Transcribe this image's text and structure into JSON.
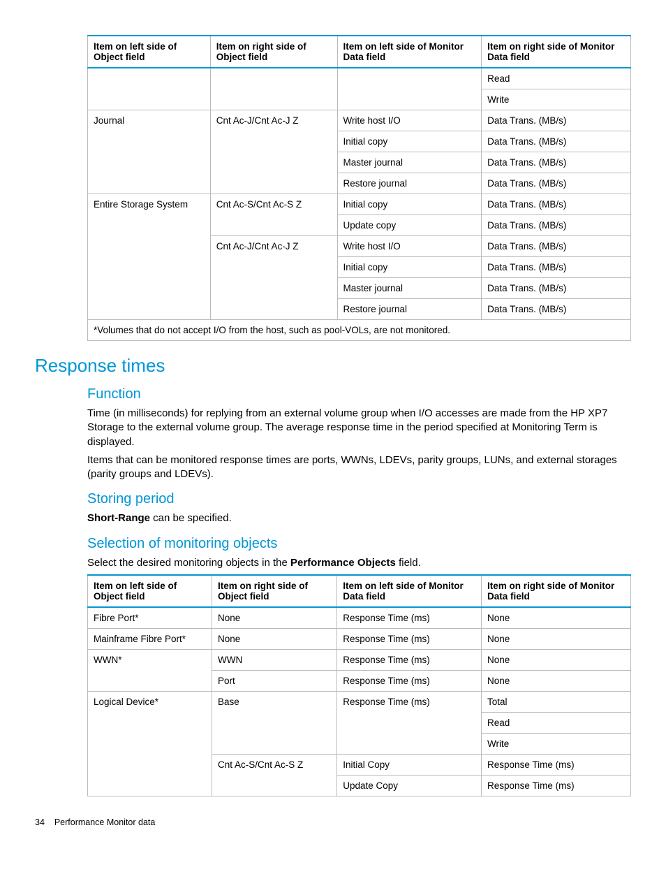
{
  "table1": {
    "headers": [
      "Item on left side of Object field",
      "Item on right side of Object field",
      "Item on left side of Monitor Data field",
      "Item on right side of Monitor Data field"
    ],
    "rows": [
      {
        "c0": "",
        "c1": "",
        "c2": "",
        "c3": "Read"
      },
      {
        "c0": "",
        "c1": "",
        "c2": "",
        "c3": "Write"
      },
      {
        "c0": "Journal",
        "c1": "Cnt Ac-J/Cnt Ac-J Z",
        "c2": "Write host I/O",
        "c3": "Data Trans. (MB/s)"
      },
      {
        "c0": "",
        "c1": "",
        "c2": "Initial copy",
        "c3": "Data Trans. (MB/s)"
      },
      {
        "c0": "",
        "c1": "",
        "c2": "Master journal",
        "c3": "Data Trans. (MB/s)"
      },
      {
        "c0": "",
        "c1": "",
        "c2": "Restore journal",
        "c3": "Data Trans. (MB/s)"
      },
      {
        "c0": "Entire Storage System",
        "c1": "Cnt Ac-S/Cnt Ac-S Z",
        "c2": "Initial copy",
        "c3": "Data Trans. (MB/s)"
      },
      {
        "c0": "",
        "c1": "",
        "c2": "Update copy",
        "c3": "Data Trans. (MB/s)"
      },
      {
        "c0": "",
        "c1": "Cnt Ac-J/Cnt Ac-J Z",
        "c2": "Write host I/O",
        "c3": "Data Trans. (MB/s)"
      },
      {
        "c0": "",
        "c1": "",
        "c2": "Initial copy",
        "c3": "Data Trans. (MB/s)"
      },
      {
        "c0": "",
        "c1": "",
        "c2": "Master journal",
        "c3": "Data Trans. (MB/s)"
      },
      {
        "c0": "",
        "c1": "",
        "c2": "Restore journal",
        "c3": "Data Trans. (MB/s)"
      }
    ],
    "footnote": "*Volumes that do not accept I/O from the host, such as pool-VOLs, are not monitored."
  },
  "section": {
    "title": "Response times",
    "function_heading": "Function",
    "function_p1": "Time (in milliseconds) for replying from an external volume group when I/O accesses are made from the HP XP7 Storage to the external volume group. The average response time in the period specified at Monitoring Term is displayed.",
    "function_p2": "Items that can be monitored response times are ports, WWNs, LDEVs, parity groups, LUNs, and external storages (parity groups and LDEVs).",
    "storing_heading": "Storing period",
    "storing_bold": "Short-Range",
    "storing_rest": " can be specified.",
    "selection_heading": "Selection of monitoring objects",
    "selection_pre": "Select the desired monitoring objects in the ",
    "selection_bold": "Performance Objects",
    "selection_post": " field."
  },
  "table2": {
    "headers": [
      "Item on left side of Object field",
      "Item on right side of Object field",
      "Item on left side of Monitor Data field",
      "Item on right side of Monitor Data field"
    ],
    "rows": [
      {
        "c0": "Fibre Port*",
        "c1": "None",
        "c2": "Response Time (ms)",
        "c3": "None"
      },
      {
        "c0": "Mainframe Fibre Port*",
        "c1": "None",
        "c2": "Response Time (ms)",
        "c3": "None"
      },
      {
        "c0": "WWN*",
        "c1": "WWN",
        "c2": "Response Time (ms)",
        "c3": "None"
      },
      {
        "c0": "",
        "c1": "Port",
        "c2": "Response Time (ms)",
        "c3": "None"
      },
      {
        "c0": "Logical Device*",
        "c1": "Base",
        "c2": "Response Time (ms)",
        "c3": "Total"
      },
      {
        "c0": "",
        "c1": "",
        "c2": "",
        "c3": "Read"
      },
      {
        "c0": "",
        "c1": "",
        "c2": "",
        "c3": "Write"
      },
      {
        "c0": "",
        "c1": "Cnt Ac-S/Cnt Ac-S Z",
        "c2": "Initial Copy",
        "c3": "Response Time (ms)"
      },
      {
        "c0": "",
        "c1": "",
        "c2": "Update Copy",
        "c3": "Response Time (ms)"
      }
    ]
  },
  "footer": {
    "page": "34",
    "title": "Performance Monitor data"
  }
}
